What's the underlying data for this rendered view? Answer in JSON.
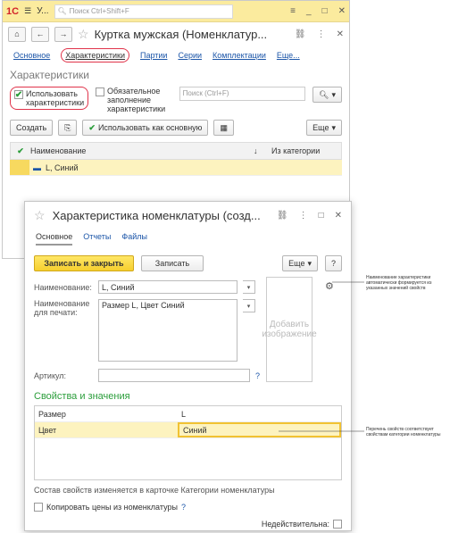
{
  "main_window": {
    "logo": "1С",
    "app_title": "У...",
    "search_placeholder": "Поиск Ctrl+Shift+F",
    "doc_title": "Куртка мужская (Номенклатур...",
    "tabs": [
      "Основное",
      "Характеристики",
      "Партии",
      "Серии",
      "Комплектации",
      "Еще..."
    ],
    "section_title": "Характеристики",
    "use_chars_label": "Использовать характеристики",
    "required_fill_label": "Обязательное заполнение характеристики",
    "search_mini_placeholder": "Поиск (Ctrl+F)",
    "create_label": "Создать",
    "use_as_main_label": "Использовать как основную",
    "more_label": "Еще",
    "col_name": "Наименование",
    "col_sort": "↓",
    "col_category": "Из категории",
    "row_name": "L, Синий"
  },
  "dialog": {
    "title": "Характеристика номенклатуры (созд...",
    "tabs": [
      "Основное",
      "Отчеты",
      "Файлы"
    ],
    "save_close_label": "Записать и закрыть",
    "save_label": "Записать",
    "more_label": "Еще",
    "help_label": "?",
    "name_label": "Наименование:",
    "name_value": "L, Синий",
    "print_label": "Наименование для печати:",
    "print_value": "Размер L, Цвет Синий",
    "article_label": "Артикул:",
    "article_help": "?",
    "add_image_label": "Добавить изображение",
    "props_title": "Свойства и значения",
    "props": [
      {
        "name": "Размер",
        "value": "L"
      },
      {
        "name": "Цвет",
        "value": "Синий"
      }
    ],
    "note": "Состав свойств изменяется в карточке Категории номенклатуры",
    "copy_prices_label": "Копировать цены из номенклатуры",
    "copy_help": "?",
    "invalid_label": "Недействительна:"
  },
  "callouts": {
    "name_note": "Наименование характеристики автоматически формируется из указанных значений свойств",
    "props_note": "Перечень свойств соответствует свойствам категории номенклатуры"
  }
}
